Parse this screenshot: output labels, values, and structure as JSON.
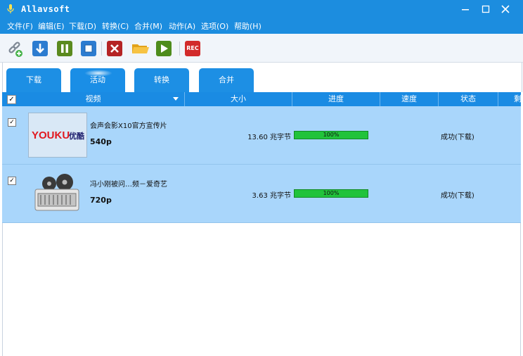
{
  "window": {
    "title": "Allavsoft"
  },
  "menu": [
    "文件(F)",
    "编辑(E)",
    "下载(D)",
    "转换(C)",
    "合并(M)",
    "动作(A)",
    "选项(O)",
    "帮助(H)"
  ],
  "toolbar": {
    "rec_label": "REC"
  },
  "tabs": [
    "下载",
    "活动",
    "转换",
    "合并"
  ],
  "columns": {
    "video": "视频",
    "size": "大小",
    "progress": "进度",
    "speed": "速度",
    "status": "状态",
    "remaining": "剩"
  },
  "rows": [
    {
      "title": "会声会影X10官方宣传片",
      "resolution": "540p",
      "size": "13.60 兆字节",
      "progress": "100%",
      "status": "成功(下载)",
      "thumb_text": "优酷",
      "thumb_logo": "YOUKU"
    },
    {
      "title": "冯小刚被问…频－爱奇艺",
      "resolution": "720p",
      "size": "3.63 兆字节",
      "progress": "100%",
      "status": "成功(下载)"
    }
  ],
  "colors": {
    "titlebar": "#1c8ddf",
    "row_bg": "#a9d6fb",
    "progress": "#21c33b",
    "tab": "#1d8fe4"
  }
}
